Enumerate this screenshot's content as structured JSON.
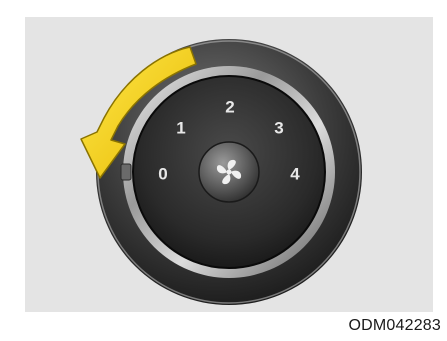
{
  "figure": {
    "code": "ODM042283",
    "subject": "fan speed control knob",
    "rotation_direction": "counterclockwise",
    "fan_icon": "fan-icon",
    "arrow_icon": "curved-arrow-icon",
    "colors": {
      "background": "#e4e4e4",
      "arrow": "#f3d21a",
      "arrow_outline": "#8a7300",
      "knob_face": "#2a2a2a",
      "numbers": "#e8e8e8"
    }
  },
  "dial": {
    "positions": [
      {
        "label": "0"
      },
      {
        "label": "1"
      },
      {
        "label": "2"
      },
      {
        "label": "3"
      },
      {
        "label": "4"
      }
    ]
  }
}
